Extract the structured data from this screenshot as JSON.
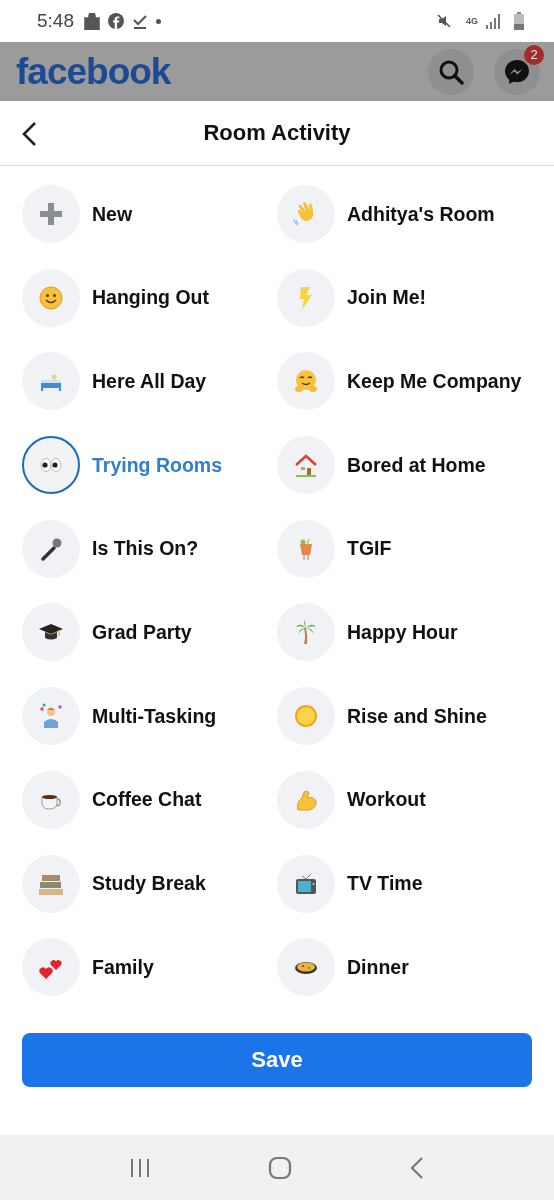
{
  "status_bar": {
    "time": "5:48",
    "network": "4G"
  },
  "app_bar": {
    "logo": "facebook",
    "messenger_badge": "2"
  },
  "header": {
    "title": "Room Activity"
  },
  "activities": [
    {
      "label": "New",
      "selected": false
    },
    {
      "label": "Adhitya's Room",
      "selected": false
    },
    {
      "label": "Hanging Out",
      "selected": false
    },
    {
      "label": "Join Me!",
      "selected": false
    },
    {
      "label": "Here All Day",
      "selected": false
    },
    {
      "label": "Keep Me Company",
      "selected": false
    },
    {
      "label": "Trying Rooms",
      "selected": true
    },
    {
      "label": "Bored at Home",
      "selected": false
    },
    {
      "label": "Is This On?",
      "selected": false
    },
    {
      "label": "TGIF",
      "selected": false
    },
    {
      "label": "Grad Party",
      "selected": false
    },
    {
      "label": "Happy Hour",
      "selected": false
    },
    {
      "label": "Multi-Tasking",
      "selected": false
    },
    {
      "label": "Rise and Shine",
      "selected": false
    },
    {
      "label": "Coffee Chat",
      "selected": false
    },
    {
      "label": "Workout",
      "selected": false
    },
    {
      "label": "Study Break",
      "selected": false
    },
    {
      "label": "TV Time",
      "selected": false
    },
    {
      "label": "Family",
      "selected": false
    },
    {
      "label": "Dinner",
      "selected": false
    }
  ],
  "save_button": {
    "label": "Save"
  }
}
